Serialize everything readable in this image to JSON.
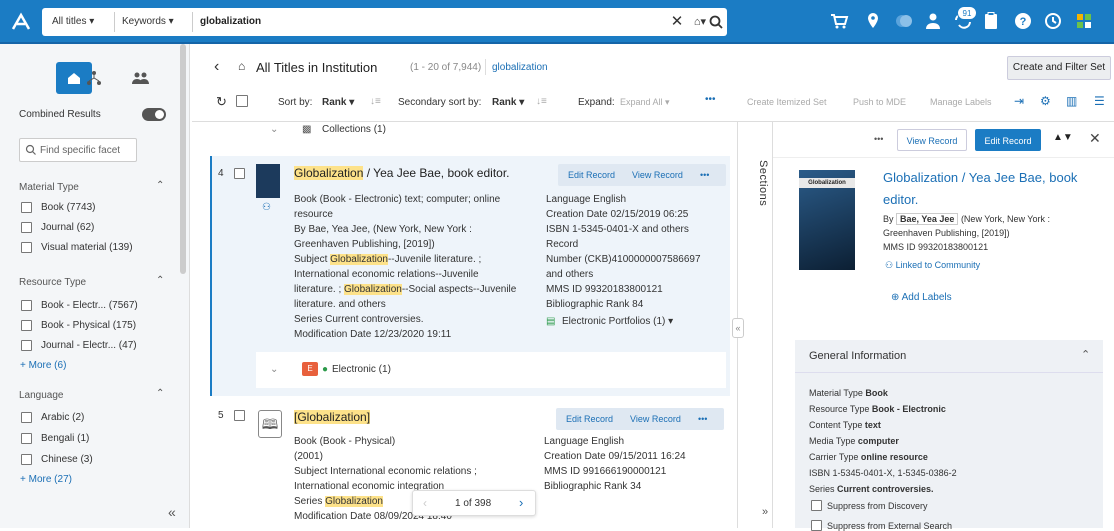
{
  "topbar": {
    "scope": "All titles",
    "search_type": "Keywords",
    "query": "globalization",
    "notification_count": "91"
  },
  "left": {
    "combined_results": "Combined Results",
    "facet_placeholder": "Find specific facet",
    "material_type": {
      "title": "Material Type",
      "items": [
        "Book (7743)",
        "Journal (62)",
        "Visual material (139)"
      ]
    },
    "resource_type": {
      "title": "Resource Type",
      "items": [
        "Book - Electr...  (7567)",
        "Book - Physical (175)",
        "Journal - Electr...  (47)"
      ],
      "more": "More (6)"
    },
    "language": {
      "title": "Language",
      "items": [
        "Arabic (2)",
        "Bengali (1)",
        "Chinese (3)"
      ],
      "more": "More (27)"
    }
  },
  "main": {
    "title": "All Titles in Institution",
    "count": "(1 - 20 of 7,944)",
    "query_chip": "globalization",
    "create_filter_set": "Create and Filter Set",
    "sort_label": "Sort by:",
    "sort_value": "Rank",
    "secondary_sort_label": "Secondary sort by:",
    "secondary_sort_value": "Rank",
    "expand_label": "Expand:",
    "expand_value": "Expand All",
    "actions": [
      "Create Itemized Set",
      "Push to MDE",
      "Manage Labels"
    ],
    "collections": "Collections (1)"
  },
  "records": [
    {
      "num": "4",
      "title_hl": "Globalization",
      "title_rest": " / Yea Jee Bae, book editor.",
      "edit": "Edit Record",
      "view": "View Record",
      "more": "•••",
      "left_lines": [
        "Book (Book - Electronic) text; computer; online",
        "resource",
        "By Bae, Yea Jee, (New York, New York :",
        "Greenhaven Publishing, [2019])",
        "Series Current controversies.",
        "Modification Date 12/23/2020 19:11"
      ],
      "subject_prefix": "Subject ",
      "subject_1": "Globalization",
      "subject_1_rest": "--Juvenile literature. ;",
      "subject_line2": "International economic relations--Juvenile",
      "subject_line3_a": "literature. ; ",
      "subject_line3_hl": "Globalization",
      "subject_line3_b": "--Social aspects--Juvenile",
      "subject_line4": "literature. and others",
      "right_lines": [
        "Language English",
        "Creation Date 02/15/2019 06:25",
        "ISBN 1-5345-0401-X and others",
        "Record",
        "Number (CKB)4100000007586697",
        "and others",
        "MMS ID 99320183800121",
        "Bibliographic Rank 84"
      ],
      "portfolios": "Electronic Portfolios (1)",
      "electronic": "Electronic (1)"
    },
    {
      "num": "5",
      "title_hl": "[Globalization]",
      "edit": "Edit Record",
      "view": "View Record",
      "more": "•••",
      "left_lines": [
        "Book (Book - Physical)",
        "(2001)",
        "Subject International economic relations ;",
        "International economic integration"
      ],
      "series_prefix": "Series ",
      "series_hl": "Globalization",
      "mod_date": "Modification Date 08/09/2024 18:40",
      "right_lines": [
        "Language English",
        "Creation Date 09/15/2011 16:24",
        "MMS ID 991666190000121",
        "Bibliographic Rank 34"
      ]
    }
  ],
  "pager": "1 of 398",
  "sections": "Sections",
  "detail": {
    "view_record": "View Record",
    "edit_record": "Edit Record",
    "title_line1": "Globalization / Yea Jee Bae, book",
    "title_line2": "editor.",
    "by_prefix": "By",
    "author": "Bae, Yea Jee",
    "pub": "(New York, New York :",
    "pub2": "Greenhaven Publishing, [2019])",
    "mms": "MMS ID 99320183800121",
    "linked": "Linked to Community",
    "add_labels": "Add Labels",
    "cover_text": "Globalization",
    "gi_title": "General Information",
    "gi_lines": [
      [
        "Material Type ",
        "Book"
      ],
      [
        "Resource Type ",
        "Book - Electronic"
      ],
      [
        "Content Type ",
        "text"
      ],
      [
        "Media Type ",
        "computer"
      ],
      [
        "Carrier Type ",
        "online resource"
      ],
      [
        "ISBN ",
        "1-5345-0401-X, 1-5345-0386-2"
      ],
      [
        "Series ",
        "Current controversies."
      ]
    ],
    "suppress1": "Suppress from Discovery",
    "suppress2": "Suppress from External Search"
  }
}
